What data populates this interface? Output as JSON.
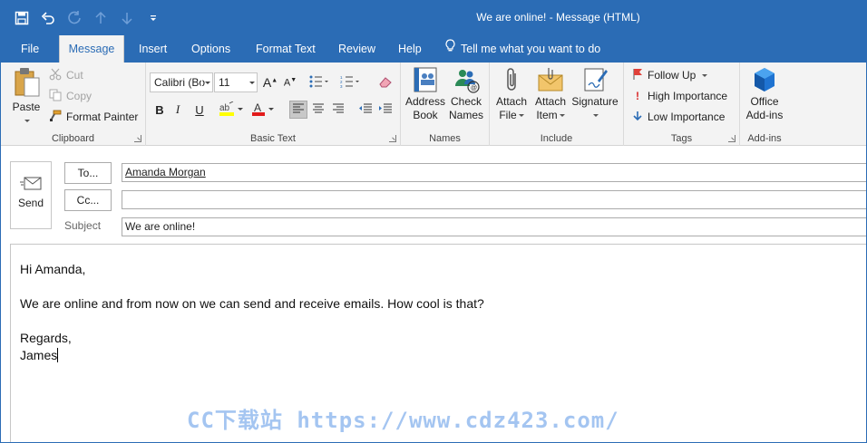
{
  "window": {
    "title": "We are online!  -  Message (HTML)",
    "accent": "#2b6cb5"
  },
  "qat": [
    {
      "name": "save-icon"
    },
    {
      "name": "undo-icon"
    },
    {
      "name": "redo-icon"
    },
    {
      "name": "arrow-up-icon"
    },
    {
      "name": "arrow-down-icon"
    },
    {
      "name": "customize-qat-icon"
    }
  ],
  "tabs": [
    {
      "label": "File"
    },
    {
      "label": "Message",
      "active": true
    },
    {
      "label": "Insert"
    },
    {
      "label": "Options"
    },
    {
      "label": "Format Text"
    },
    {
      "label": "Review"
    },
    {
      "label": "Help"
    },
    {
      "label": "Tell me what you want to do",
      "icon": "lightbulb-icon"
    }
  ],
  "ribbon": {
    "clipboard": {
      "label": "Clipboard",
      "paste": "Paste",
      "cut": "Cut",
      "copy": "Copy",
      "format_painter": "Format Painter"
    },
    "basic_text": {
      "label": "Basic Text",
      "font_name": "Calibri (Bo",
      "font_size": "11",
      "bold": "B",
      "italic": "I",
      "underline": "U"
    },
    "names": {
      "label": "Names",
      "address_book": [
        "Address",
        "Book"
      ],
      "check_names": [
        "Check",
        "Names"
      ]
    },
    "include": {
      "label": "Include",
      "attach_file": [
        "Attach",
        "File"
      ],
      "attach_item": [
        "Attach",
        "Item"
      ],
      "signature": "Signature"
    },
    "tags": {
      "label": "Tags",
      "follow_up": "Follow Up",
      "high_importance": "High Importance",
      "low_importance": "Low Importance"
    },
    "addins": {
      "label": "Add-ins",
      "office_addins": [
        "Office",
        "Add-ins"
      ]
    }
  },
  "compose": {
    "send_label": "Send",
    "to_label": "To...",
    "cc_label": "Cc...",
    "subject_label": "Subject",
    "to_value": "Amanda Morgan",
    "cc_value": "",
    "subject_value": "We are online!"
  },
  "body_text": {
    "greeting": "Hi Amanda,",
    "line1": "We are online and from now on we can send and receive emails. How cool is that?",
    "closing": "Regards,",
    "signature": "James"
  },
  "watermark": "CC下载站 https://www.cdz423.com/"
}
